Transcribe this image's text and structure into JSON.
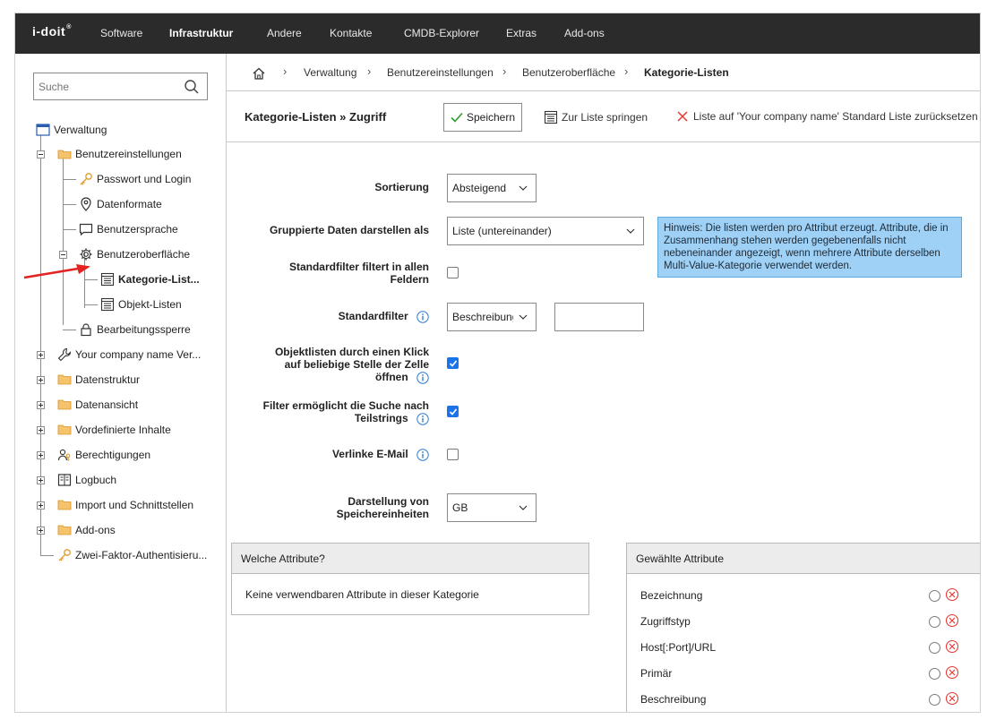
{
  "topnav": {
    "logo": "i-doit",
    "items": [
      "Software",
      "Infrastruktur",
      "Andere",
      "Kontakte",
      "CMDB-Explorer",
      "Extras",
      "Add-ons"
    ],
    "active": "Infrastruktur"
  },
  "sidebar": {
    "search_placeholder": "Suche",
    "tree": {
      "root": "Verwaltung",
      "benutzereinstellungen": "Benutzereinstellungen",
      "passwort": "Passwort und Login",
      "datenformate": "Datenformate",
      "benutzersprache": "Benutzersprache",
      "benutzeroberflaeche": "Benutzeroberfläche",
      "kategorie_listen": "Kategorie-List...",
      "objekt_listen": "Objekt-Listen",
      "bearbeitungssperre": "Bearbeitungssperre",
      "company": "Your company name Ver...",
      "datenstruktur": "Datenstruktur",
      "datenansicht": "Datenansicht",
      "vordefinierte": "Vordefinierte Inhalte",
      "berechtigungen": "Berechtigungen",
      "logbuch": "Logbuch",
      "import": "Import und Schnittstellen",
      "addons": "Add-ons",
      "zwei_faktor": "Zwei-Faktor-Authentisieru..."
    }
  },
  "breadcrumb": [
    "Verwaltung",
    "Benutzereinstellungen",
    "Benutzeroberfläche",
    "Kategorie-Listen"
  ],
  "toolbar": {
    "title": "Kategorie-Listen » Zugriff",
    "save": "Speichern",
    "goto_list": "Zur Liste springen",
    "reset": "Liste auf 'Your company name' Standard Liste zurücksetzen"
  },
  "form": {
    "sortierung_label": "Sortierung",
    "sortierung_value": "Absteigend",
    "gruppiert_label": "Gruppierte Daten darstellen als",
    "gruppiert_value": "Liste (untereinander)",
    "standardfilter_alle_label_1": "Standardfilter filtert in allen",
    "standardfilter_alle_label_2": "Feldern",
    "standardfilter_alle_checked": false,
    "standardfilter_label": "Standardfilter",
    "standardfilter_value": "Beschreibung",
    "standardfilter_text": "",
    "objektlisten_label_1": "Objektlisten durch einen Klick",
    "objektlisten_label_2": "auf beliebige Stelle der Zelle",
    "objektlisten_label_3": "öffnen",
    "objektlisten_checked": true,
    "teilstrings_label_1": "Filter ermöglicht die Suche nach",
    "teilstrings_label_2": "Teilstrings",
    "teilstrings_checked": true,
    "email_label": "Verlinke E-Mail",
    "email_checked": false,
    "speicher_label_1": "Darstellung von",
    "speicher_label_2": "Speichereinheiten",
    "speicher_value": "GB"
  },
  "hint": "Hinweis: Die listen werden pro Attribut erzeugt. Attribute, die in Zusammenhang stehen werden gegebenenfalls nicht nebeneinander angezeigt, wenn mehrere Attribute derselben Multi-Value-Kategorie verwendet werden.",
  "attributes_panel": {
    "title": "Welche Attribute?",
    "empty": "Keine verwendbaren Attribute in dieser Kategorie"
  },
  "chosen_panel": {
    "title": "Gewählte Attribute",
    "items": [
      "Bezeichnung",
      "Zugriffstyp",
      "Host[:Port]/URL",
      "Primär",
      "Beschreibung"
    ]
  },
  "colors": {
    "nav_bg": "#2b2b2b",
    "hint_bg": "#9fd0f5",
    "checkbox": "#1a73e8",
    "remove": "#e53935",
    "arrow": "#e32222"
  }
}
